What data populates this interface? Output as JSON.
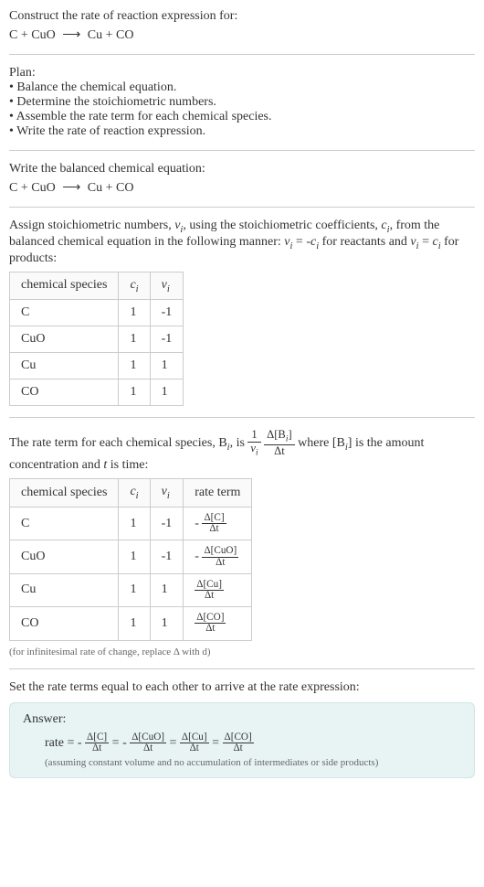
{
  "intro": {
    "prompt": "Construct the rate of reaction expression for:",
    "equation_lhs": "C + CuO",
    "equation_arrow": "⟶",
    "equation_rhs": "Cu + CO"
  },
  "plan": {
    "heading": "Plan:",
    "bullets": [
      "• Balance the chemical equation.",
      "• Determine the stoichiometric numbers.",
      "• Assemble the rate term for each chemical species.",
      "• Write the rate of reaction expression."
    ]
  },
  "balanced": {
    "prompt": "Write the balanced chemical equation:",
    "equation_lhs": "C + CuO",
    "equation_arrow": "⟶",
    "equation_rhs": "Cu + CO"
  },
  "stoich": {
    "intro_pre": "Assign stoichiometric numbers, ",
    "nu_i": "ν",
    "intro_mid1": ", using the stoichiometric coefficients, ",
    "c_i": "c",
    "intro_mid2": ", from the balanced chemical equation in the following manner: ",
    "rel_reactants": " = -",
    "intro_mid3": " for reactants and ",
    "rel_products": " = ",
    "intro_end": " for products:",
    "headers": {
      "species": "chemical species",
      "c": "c",
      "nu": "ν"
    },
    "rows": [
      {
        "species": "C",
        "c": "1",
        "nu": "-1"
      },
      {
        "species": "CuO",
        "c": "1",
        "nu": "-1"
      },
      {
        "species": "Cu",
        "c": "1",
        "nu": "1"
      },
      {
        "species": "CO",
        "c": "1",
        "nu": "1"
      }
    ]
  },
  "rateterm": {
    "intro_pre": "The rate term for each chemical species, B",
    "intro_mid1": ", is ",
    "nu_i": "ν",
    "one": "1",
    "deltaB_num": "Δ[B",
    "deltaB_num_end": "]",
    "delta_t": "Δt",
    "intro_mid2": " where [B",
    "intro_mid3": "] is the amount concentration and ",
    "t": "t",
    "intro_end": " is time:",
    "headers": {
      "species": "chemical species",
      "c": "c",
      "nu": "ν",
      "rate": "rate term"
    },
    "rows": [
      {
        "species": "C",
        "c": "1",
        "nu": "-1",
        "sign": "-",
        "dnum": "Δ[C]",
        "dden": "Δt"
      },
      {
        "species": "CuO",
        "c": "1",
        "nu": "-1",
        "sign": "-",
        "dnum": "Δ[CuO]",
        "dden": "Δt"
      },
      {
        "species": "Cu",
        "c": "1",
        "nu": "1",
        "sign": "",
        "dnum": "Δ[Cu]",
        "dden": "Δt"
      },
      {
        "species": "CO",
        "c": "1",
        "nu": "1",
        "sign": "",
        "dnum": "Δ[CO]",
        "dden": "Δt"
      }
    ],
    "footnote": "(for infinitesimal rate of change, replace Δ with d)"
  },
  "final": {
    "prompt": "Set the rate terms equal to each other to arrive at the rate expression:",
    "answer_label": "Answer:",
    "rate_eq_prefix": "rate = ",
    "terms": [
      {
        "sign": "-",
        "num": "Δ[C]",
        "den": "Δt"
      },
      {
        "sign": "-",
        "num": "Δ[CuO]",
        "den": "Δt"
      },
      {
        "sign": "",
        "num": "Δ[Cu]",
        "den": "Δt"
      },
      {
        "sign": "",
        "num": "Δ[CO]",
        "den": "Δt"
      }
    ],
    "eq": " = ",
    "note": "(assuming constant volume and no accumulation of intermediates or side products)"
  }
}
